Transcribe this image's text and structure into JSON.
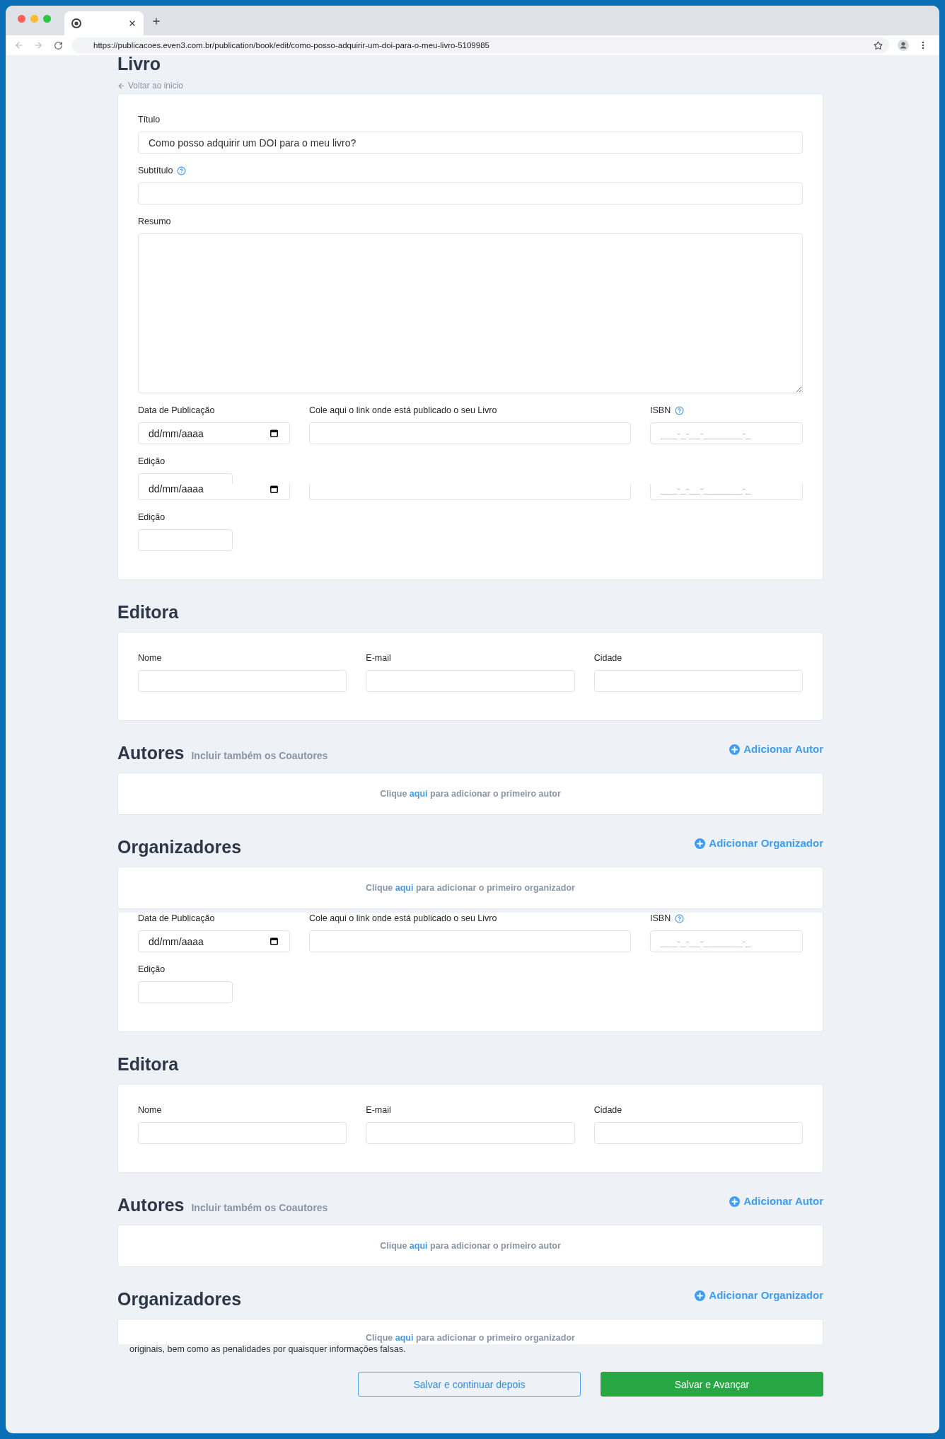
{
  "browser": {
    "url": "https://publicacoes.even3.com.br/publication/book/edit/como-posso-adquirir-um-doi-para-o-meu-livro-5109985"
  },
  "page": {
    "title": "Livro",
    "back_link": "Voltar ao inicio"
  },
  "sections": [
    {
      "kind": "form",
      "rows": [
        {
          "kind": "full",
          "fields": [
            {
              "label": "Título",
              "kind": "text",
              "help": false,
              "value": "Como posso adquirir um DOI para o meu livro?"
            }
          ]
        },
        {
          "kind": "full",
          "fields": [
            {
              "label": "Subtítulo",
              "kind": "text",
              "help": true
            }
          ]
        },
        {
          "kind": "full",
          "fields": [
            {
              "label": "Resumo",
              "kind": "textarea",
              "help": false
            }
          ]
        },
        {
          "kind": "publication",
          "fields": [
            {
              "label": "Data de Publicação",
              "kind": "date",
              "help": false,
              "placeholder": "dd/mm/aaaa"
            },
            {
              "label": "Cole aqui o link onde está publicado o seu Livro",
              "kind": "text",
              "help": false
            },
            {
              "label": "ISBN",
              "kind": "text",
              "help": true,
              "placeholder": "___-_-__-_______-_"
            }
          ]
        },
        {
          "kind": "head",
          "fields": [
            {
              "label": "Edição",
              "kind": "text",
              "help": false
            }
          ]
        },
        {
          "kind": "tail",
          "fields": [
            {
              "kind": "date",
              "placeholder": "dd/mm/aaaa"
            },
            {
              "kind": "text"
            },
            {
              "kind": "text",
              "placeholder": "___-_-__-_______-_"
            }
          ]
        },
        {
          "kind": "short",
          "fields": [
            {
              "label": "Edição",
              "kind": "text",
              "help": false
            }
          ]
        }
      ]
    },
    {
      "kind": "form",
      "title": "Editora",
      "rows": [
        {
          "kind": "triple",
          "fields": [
            {
              "label": "Nome",
              "kind": "text",
              "help": false
            },
            {
              "label": "E-mail",
              "kind": "text",
              "help": false
            },
            {
              "label": "Cidade",
              "kind": "text",
              "help": false
            }
          ]
        }
      ]
    },
    {
      "kind": "list",
      "title": "Autores",
      "note": "Incluir também os Coautores",
      "action": "Adicionar Autor",
      "empty": {
        "before": "Clique",
        "link": "aqui",
        "after": "para adicionar o primeiro autor"
      }
    },
    {
      "kind": "list",
      "title": "Organizadores",
      "action": "Adicionar Organizador",
      "empty": {
        "before": "Clique",
        "link": "aqui",
        "after": "para adicionar o primeiro organizador"
      }
    },
    {
      "kind": "tail",
      "rows": [
        {
          "kind": "publication",
          "fields": [
            {
              "label": "Data de Publicação",
              "kind": "date",
              "help": false,
              "placeholder": "dd/mm/aaaa"
            },
            {
              "label": "Cole aqui o link onde está publicado o seu Livro",
              "kind": "text",
              "help": false
            },
            {
              "label": "ISBN",
              "kind": "text",
              "help": true,
              "placeholder": "___-_-__-_______-_"
            }
          ]
        },
        {
          "kind": "short",
          "fields": [
            {
              "label": "Edição",
              "kind": "text",
              "help": false
            }
          ]
        }
      ]
    },
    {
      "kind": "form",
      "title": "Editora",
      "rows": [
        {
          "kind": "triple",
          "fields": [
            {
              "label": "Nome",
              "kind": "text",
              "help": false
            },
            {
              "label": "E-mail",
              "kind": "text",
              "help": false
            },
            {
              "label": "Cidade",
              "kind": "text",
              "help": false
            }
          ]
        }
      ]
    },
    {
      "kind": "list",
      "title": "Autores",
      "note": "Incluir também os Coautores",
      "action": "Adicionar Autor",
      "empty": {
        "before": "Clique",
        "link": "aqui",
        "after": "para adicionar o primeiro autor"
      }
    },
    {
      "kind": "head",
      "title": "Organizadores",
      "action": "Adicionar Organizador",
      "empty": {
        "before": "Clique",
        "link": "aqui",
        "after": "para adicionar o primeiro organizador"
      }
    }
  ],
  "footer": {
    "disclaimer": "originais, bem como as penalidades por quaisquer informações falsas.",
    "buttons": [
      {
        "kind": "secondary",
        "label": "Salvar e continuar depois"
      },
      {
        "kind": "primary",
        "label": "Salvar e Avançar"
      }
    ]
  }
}
